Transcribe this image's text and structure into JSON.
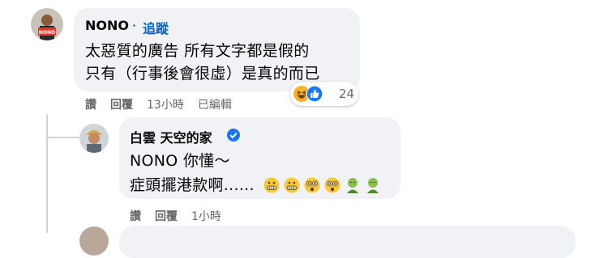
{
  "comment1": {
    "author": "NONO",
    "separator": "·",
    "follow_label": "追蹤",
    "lines": [
      "太惡質的廣告 所有文字都是假的",
      "只有（行事後會很虛）是真的而已"
    ],
    "reaction_count": "24",
    "reaction_icons": [
      "laughing-emoji",
      "like-thumb"
    ],
    "actions": {
      "like": "讚",
      "reply": "回覆",
      "time": "13小時",
      "edited": "已編輯"
    },
    "avatar_badge": "NONO"
  },
  "comment2": {
    "author": "白雲 天空的家",
    "lines": [
      "NONO 你懂～",
      "症頭擺港款啊......"
    ],
    "emojis": [
      "grimacing-face",
      "grimacing-face",
      "dizzy-face",
      "dizzy-face",
      "nauseated-face",
      "nauseated-face"
    ],
    "actions": {
      "like": "讚",
      "reply": "回覆",
      "time": "1小時"
    }
  },
  "colors": {
    "bubble": "#f0f2f5",
    "link": "#0064d1",
    "meta": "#65676b",
    "verified": "#1877f2"
  }
}
